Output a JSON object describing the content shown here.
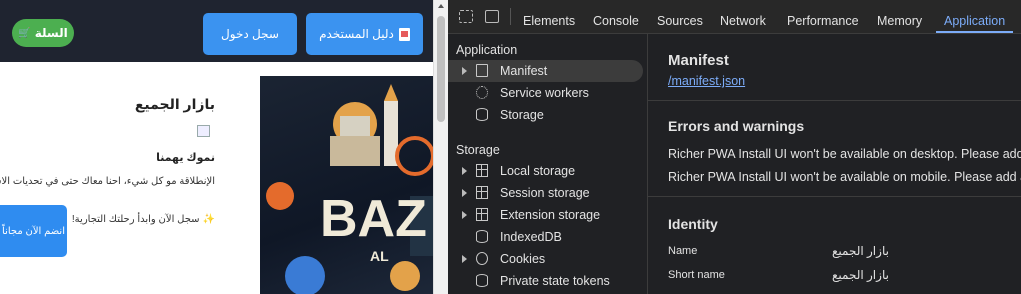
{
  "page": {
    "cart_label": "السلة",
    "cart_icon": "cart-icon",
    "login_label": "سجل دخول",
    "guide_label": "دليل المستخدم",
    "guide_icon": "book-icon",
    "shop_title": "بازار الجميع",
    "subtitle": "نموك يهمنا",
    "description": "الإنطلاقة مو كل شيء، احنا معاك حتى في تحديات الاستمرارية",
    "cta_text": "سجل الآن وابدأ رحلتك التجارية!",
    "cta_icon": "sparkles-icon",
    "join_label": "انضم الآن مجاناً",
    "hero_icon": "bazaar-logo-image",
    "hero_text": "BAZ",
    "hero_sub": "AL"
  },
  "devtools": {
    "tabs": [
      "Elements",
      "Console",
      "Sources",
      "Network",
      "Performance",
      "Memory",
      "Application"
    ],
    "active_tab": "Application",
    "sidebar": {
      "application_heading": "Application",
      "application_items": [
        "Manifest",
        "Service workers",
        "Storage"
      ],
      "storage_heading": "Storage",
      "storage_items": [
        "Local storage",
        "Session storage",
        "Extension storage",
        "IndexedDB",
        "Cookies",
        "Private state tokens"
      ]
    },
    "main": {
      "title": "Manifest",
      "link": "/manifest.json",
      "errors_heading": "Errors and warnings",
      "warnings": [
        "Richer PWA Install UI won't be available on desktop. Please add at l",
        "Richer PWA Install UI won't be available on mobile. Please add at le"
      ],
      "identity_heading": "Identity",
      "identity": [
        {
          "key": "Name",
          "value": "بازار الجميع"
        },
        {
          "key": "Short name",
          "value": "بازار الجميع"
        }
      ]
    }
  }
}
